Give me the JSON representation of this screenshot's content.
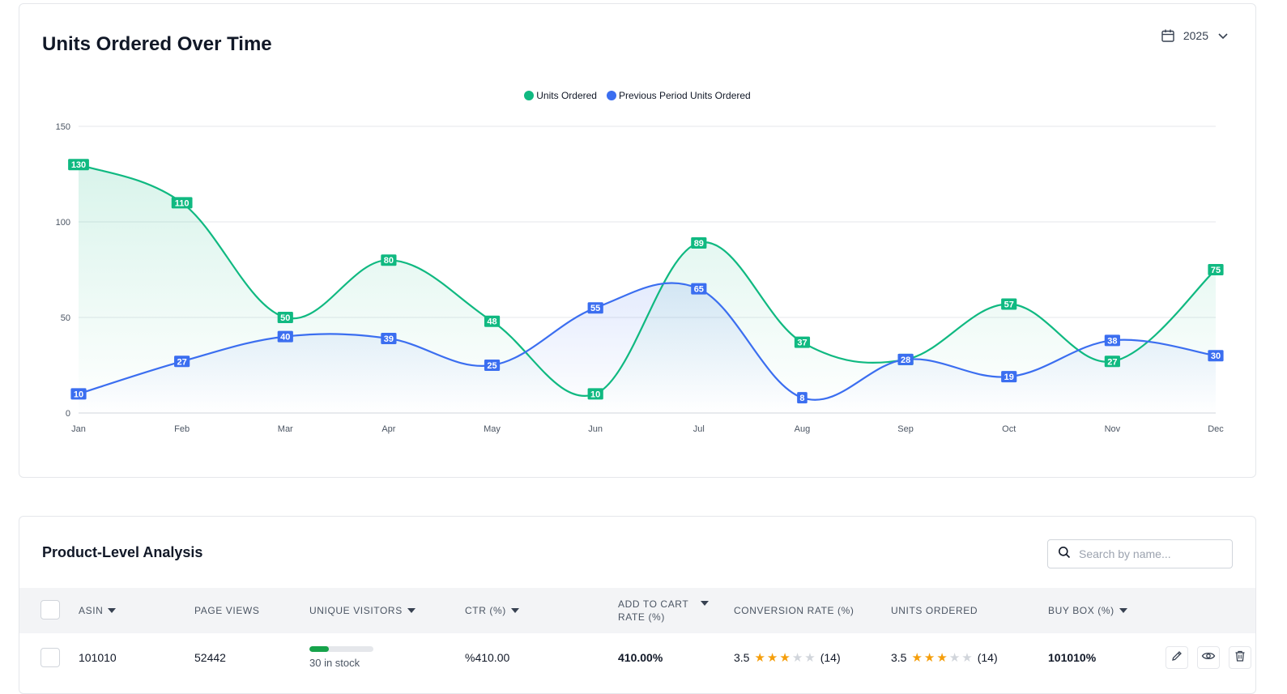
{
  "chart_card": {
    "title": "Units Ordered Over Time",
    "year": "2025"
  },
  "chart_data": {
    "type": "area",
    "title": "Units Ordered Over Time",
    "categories": [
      "Jan",
      "Feb",
      "Mar",
      "Apr",
      "May",
      "Jun",
      "Jul",
      "Aug",
      "Sep",
      "Oct",
      "Nov",
      "Dec"
    ],
    "series": [
      {
        "name": "Units Ordered",
        "color": "#10b981",
        "values": [
          130,
          110,
          50,
          80,
          48,
          10,
          89,
          37,
          28,
          57,
          27,
          75
        ]
      },
      {
        "name": "Previous Period Units Ordered",
        "color": "#3b6ef0",
        "values": [
          10,
          27,
          40,
          39,
          25,
          55,
          65,
          8,
          28,
          19,
          38,
          30
        ]
      }
    ],
    "ylim": [
      0,
      150
    ],
    "yticks": [
      0,
      50,
      100,
      150
    ],
    "grid": true,
    "legend": "top-center",
    "data_labels": true,
    "curve": "smooth"
  },
  "table_card": {
    "title": "Product-Level Analysis",
    "search_placeholder": "Search by name...",
    "columns": [
      {
        "label": "ASIN",
        "sortable": true
      },
      {
        "label": "PAGE VIEWS",
        "sortable": false
      },
      {
        "label": "UNIQUE VISITORS",
        "sortable": true
      },
      {
        "label": "CTR (%)",
        "sortable": true
      },
      {
        "label": "ADD TO CART RATE (%)",
        "sortable": true
      },
      {
        "label": "CONVERSION RATE (%)",
        "sortable": false
      },
      {
        "label": "UNITS ORDERED",
        "sortable": false
      },
      {
        "label": "BUY BOX (%)",
        "sortable": true
      }
    ],
    "rows": [
      {
        "asin": "101010",
        "page_views": "52442",
        "stock_text": "30 in stock",
        "stock_level": 0.3,
        "ctr": "%410.00",
        "add_to_cart_rate": "410.00%",
        "conversion_rating": "3.5",
        "conversion_count": "(14)",
        "conversion_stars": 3.5,
        "units_rating": "3.5",
        "units_count": "(14)",
        "units_stars": 3.5,
        "buy_box": "101010%"
      }
    ]
  },
  "icons": {
    "calendar": "calendar-icon",
    "chevron": "chevron-down-icon",
    "search": "search-icon",
    "edit": "pencil-icon",
    "view": "eye-icon",
    "delete": "trash-icon"
  }
}
